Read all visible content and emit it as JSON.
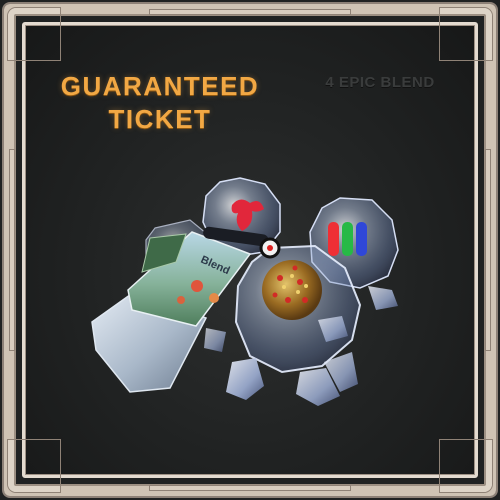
{
  "item": {
    "title_line1": "GUARANTEED",
    "title_line2": "TICKET",
    "subtitle": "4 EPIC BLEND",
    "ticket_brand": "Blend"
  },
  "colors": {
    "title": "#f2a844",
    "frame": "#cfc3b4",
    "background": "#202222"
  }
}
